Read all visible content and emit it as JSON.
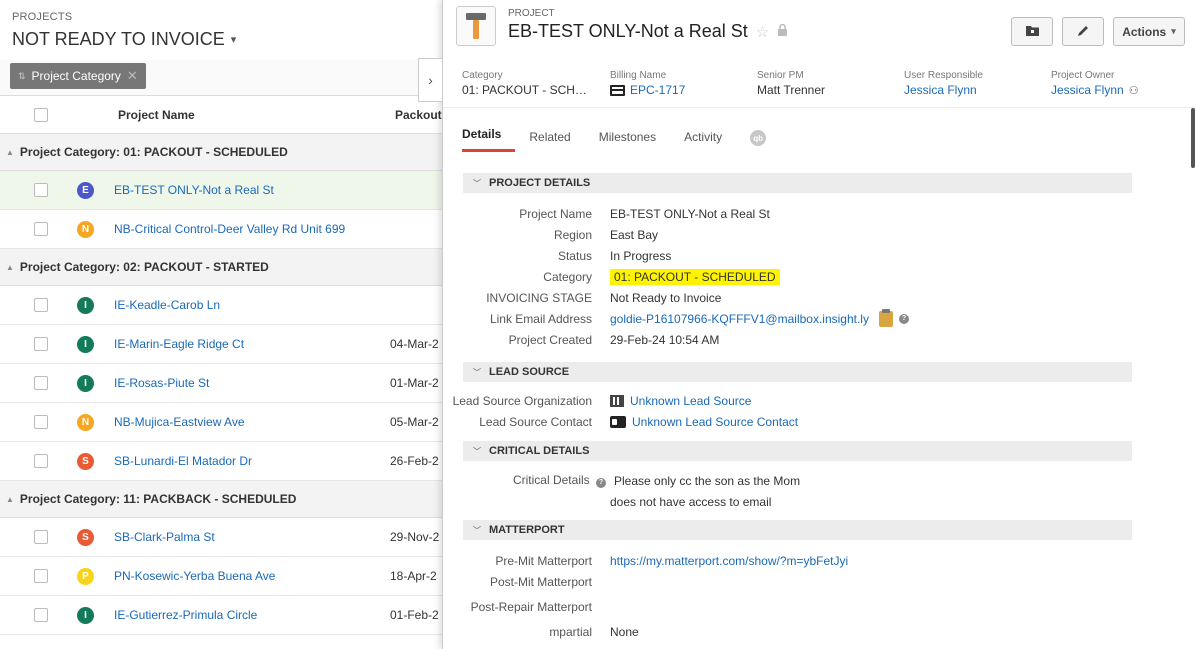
{
  "left": {
    "kicker": "PROJECTS",
    "title": "NOT READY TO INVOICE",
    "filter_chip": "Project Category",
    "columns": {
      "name": "Project Name",
      "packout": "Packout"
    },
    "groups": [
      {
        "label": "Project Category: 01: PACKOUT - SCHEDULED",
        "rows": [
          {
            "letter": "E",
            "color": "#4a57c8",
            "name": "EB-TEST ONLY-Not a Real St",
            "date": "",
            "active": true
          },
          {
            "letter": "N",
            "color": "#f5a623",
            "name": "NB-Critical Control-Deer Valley Rd Unit 699",
            "date": ""
          }
        ]
      },
      {
        "label": "Project Category: 02: PACKOUT - STARTED",
        "rows": [
          {
            "letter": "I",
            "color": "#137a5a",
            "name": "IE-Keadle-Carob Ln",
            "date": ""
          },
          {
            "letter": "I",
            "color": "#137a5a",
            "name": "IE-Marin-Eagle Ridge Ct",
            "date": "04-Mar-2"
          },
          {
            "letter": "I",
            "color": "#137a5a",
            "name": "IE-Rosas-Piute St",
            "date": "01-Mar-2"
          },
          {
            "letter": "N",
            "color": "#f5a623",
            "name": "NB-Mujica-Eastview Ave",
            "date": "05-Mar-2"
          },
          {
            "letter": "S",
            "color": "#ea5a33",
            "name": "SB-Lunardi-El Matador Dr",
            "date": "26-Feb-2"
          }
        ]
      },
      {
        "label": "Project Category: 11: PACKBACK - SCHEDULED",
        "rows": [
          {
            "letter": "S",
            "color": "#ea5a33",
            "name": "SB-Clark-Palma St",
            "date": "29-Nov-2"
          },
          {
            "letter": "P",
            "color": "#f7d31a",
            "name": "PN-Kosewic-Yerba Buena Ave",
            "date": "18-Apr-2"
          },
          {
            "letter": "I",
            "color": "#137a5a",
            "name": "IE-Gutierrez-Primula Circle",
            "date": "01-Feb-2"
          }
        ]
      }
    ]
  },
  "record": {
    "kicker": "PROJECT",
    "title": "EB-TEST ONLY-Not a Real St",
    "actions_label": "Actions",
    "summary": {
      "category_label": "Category",
      "category": "01: PACKOUT - SCH…",
      "billing_label": "Billing Name",
      "billing": "EPC-1717",
      "pm_label": "Senior PM",
      "pm": "Matt Trenner",
      "user_label": "User Responsible",
      "user": "Jessica Flynn",
      "owner_label": "Project Owner",
      "owner": "Jessica Flynn"
    },
    "tabs": [
      "Details",
      "Related",
      "Milestones",
      "Activity"
    ],
    "qb_icon": "qb",
    "sections": {
      "project_details": {
        "title": "PROJECT DETAILS",
        "project_name_label": "Project Name",
        "project_name": "EB-TEST ONLY-Not a Real St",
        "region_label": "Region",
        "region": "East Bay",
        "status_label": "Status",
        "status": "In Progress",
        "category_label": "Category",
        "category": "01: PACKOUT - SCHEDULED",
        "invoicing_label": "INVOICING STAGE",
        "invoicing": "Not Ready to Invoice",
        "email_label": "Link Email Address",
        "email": "goldie-P16107966-KQFFFV1@mailbox.insight.ly",
        "created_label": "Project Created",
        "created": "29-Feb-24 10:54 AM"
      },
      "lead_source": {
        "title": "LEAD SOURCE",
        "org_label": "Lead Source Organization",
        "org": "Unknown Lead Source",
        "contact_label": "Lead Source Contact",
        "contact": "Unknown Lead Source Contact"
      },
      "critical": {
        "title": "CRITICAL DETAILS",
        "label": "Critical Details",
        "line1": "Please only cc the son as the Mom",
        "line2": "does not have access to email"
      },
      "matterport": {
        "title": "MATTERPORT",
        "pre_label": "Pre-Mit Matterport",
        "pre": "https://my.matterport.com/show/?m=ybFetJyi",
        "post_label": "Post-Mit Matterport",
        "post": "",
        "repair_label": "Post-Repair Matterport",
        "repair": "",
        "mpartial_label": "mpartial",
        "mpartial": "None"
      }
    }
  },
  "colors": {
    "link": "#1a69b8",
    "highlight": "#fff300",
    "tab_accent": "#d9452d"
  }
}
